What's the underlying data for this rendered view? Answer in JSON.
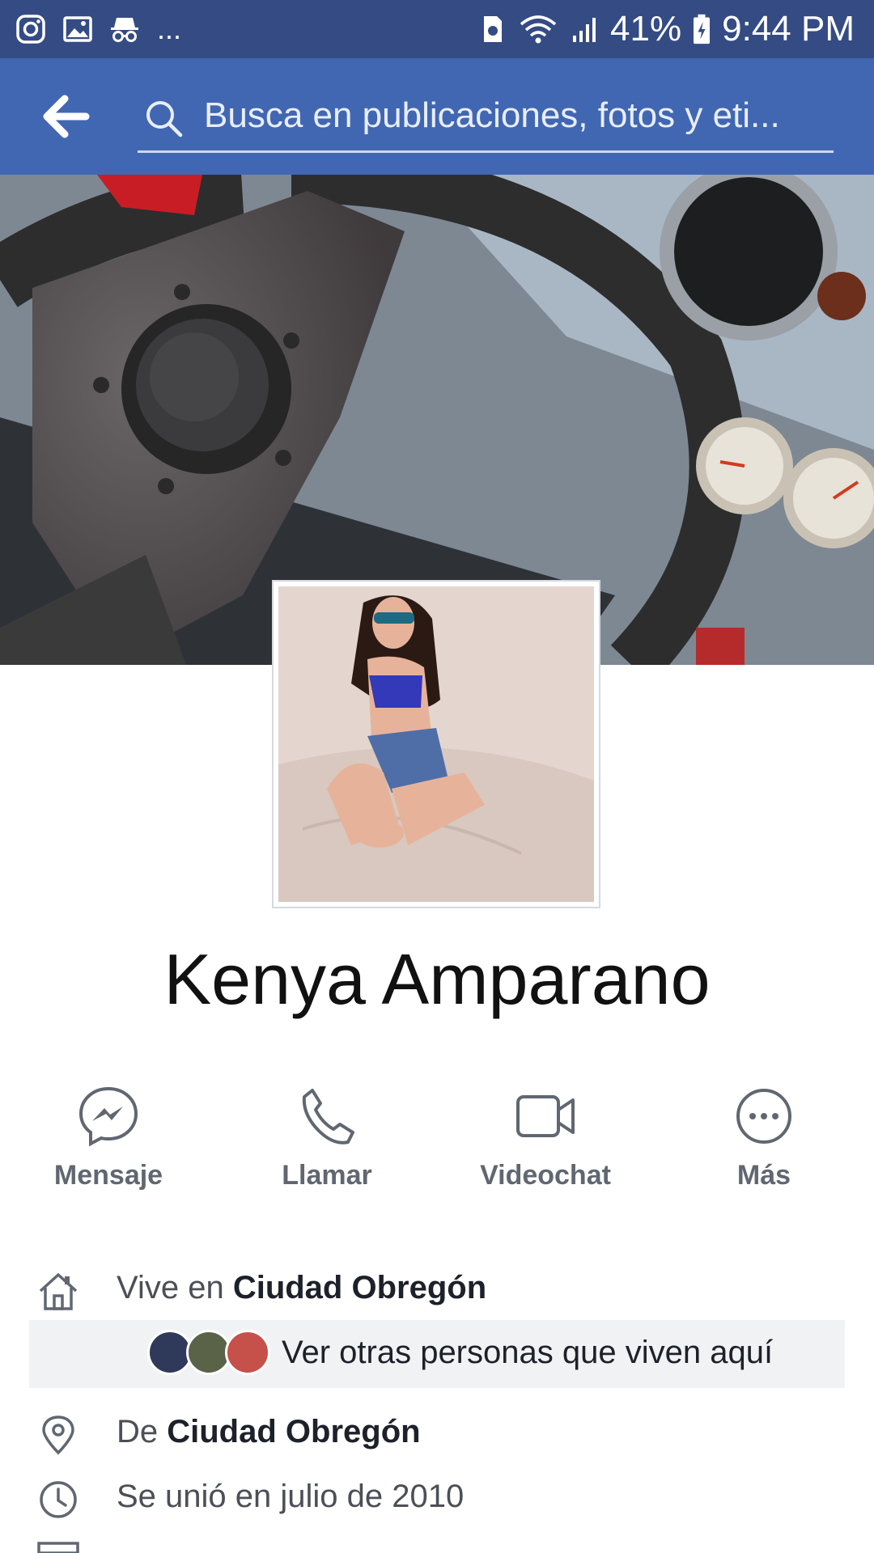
{
  "status_bar": {
    "battery": "41%",
    "time": "9:44 PM",
    "left_icons": [
      "instagram-icon",
      "gallery-icon",
      "incognito-icon"
    ],
    "overflow": "..."
  },
  "search": {
    "placeholder": "Busca en publicaciones, fotos y eti..."
  },
  "profile": {
    "name": "Kenya Amparano"
  },
  "actions": [
    {
      "label": "Mensaje",
      "icon": "messenger-icon"
    },
    {
      "label": "Llamar",
      "icon": "phone-icon"
    },
    {
      "label": "Videochat",
      "icon": "video-icon"
    },
    {
      "label": "Más",
      "icon": "more-icon"
    }
  ],
  "info": {
    "lives_prefix": "Vive en ",
    "lives_place": "Ciudad Obregón",
    "nearby_label": "Ver otras personas que viven aquí",
    "from_prefix": "De ",
    "from_place": "Ciudad Obregón",
    "joined": "Se unió en julio de 2010"
  },
  "colors": {
    "status_bar": "#344b84",
    "app_bar": "#4267b2",
    "action_gray": "#606770"
  }
}
